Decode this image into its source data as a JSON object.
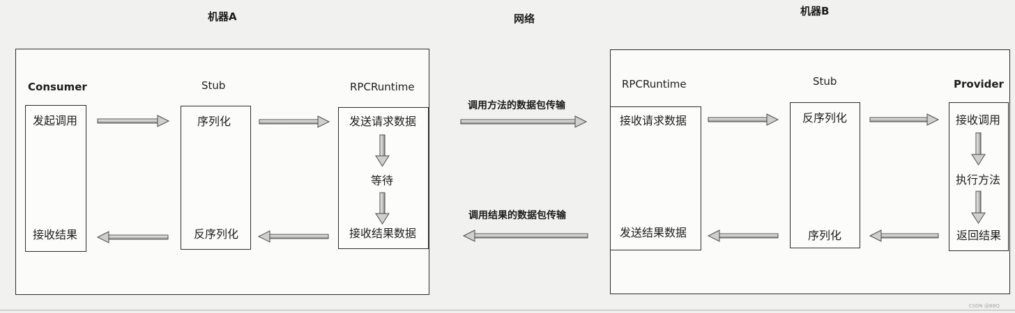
{
  "machine_a": {
    "title": "机器A",
    "consumer": {
      "title": "Consumer",
      "call": "发起调用",
      "receive": "接收结果"
    },
    "stub": {
      "title": "Stub",
      "serialize": "序列化",
      "deserialize": "反序列化"
    },
    "runtime": {
      "title": "RPCRuntime",
      "send": "发送请求数据",
      "wait": "等待",
      "receive": "接收结果数据"
    }
  },
  "network": {
    "title": "网络",
    "request_label": "调用方法的数据包传输",
    "response_label": "调用结果的数据包传输"
  },
  "machine_b": {
    "title": "机器B",
    "runtime": {
      "title": "RPCRuntime",
      "receive": "接收请求数据",
      "send": "发送结果数据"
    },
    "stub": {
      "title": "Stub",
      "deserialize": "反序列化",
      "serialize": "序列化"
    },
    "provider": {
      "title": "Provider",
      "receive_call": "接收调用",
      "execute": "执行方法",
      "return": "返回结果"
    }
  },
  "watermark": "CSDN @BBQ"
}
